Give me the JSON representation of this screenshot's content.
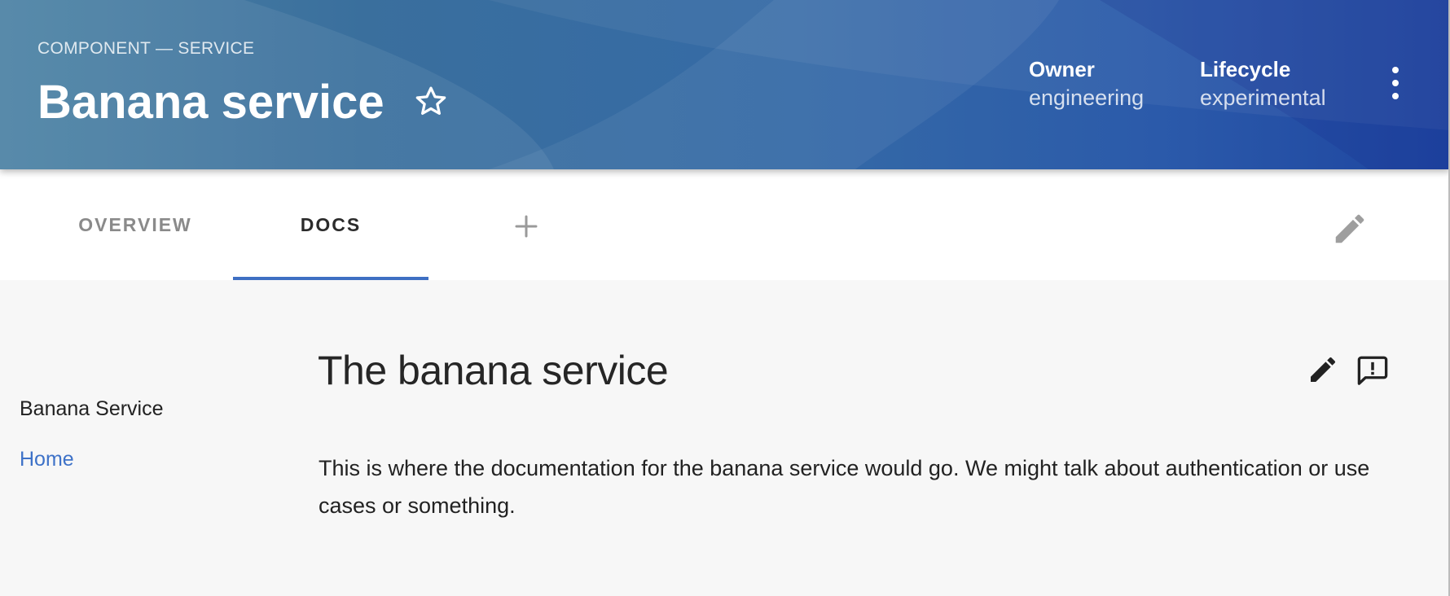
{
  "header": {
    "eyebrow": "COMPONENT — SERVICE",
    "title": "Banana service",
    "star_icon": "star-outline-icon",
    "owner": {
      "label": "Owner",
      "value": "engineering"
    },
    "lifecycle": {
      "label": "Lifecycle",
      "value": "experimental"
    },
    "more_icon": "more-vert-icon",
    "gradient_colors": [
      "#4c82a4",
      "#356aa6",
      "#1e45a0"
    ]
  },
  "tabs": {
    "items": [
      {
        "label": "OVERVIEW",
        "active": false
      },
      {
        "label": "DOCS",
        "active": true
      }
    ],
    "add_icon": "plus-icon",
    "edit_icon": "pencil-icon",
    "indicator_color": "#3e6fc3"
  },
  "sidebar": {
    "title": "Banana Service",
    "links": [
      {
        "label": "Home"
      }
    ],
    "link_color": "#3e72c8"
  },
  "doc": {
    "title": "The banana service",
    "body": "This is where the documentation for the banana service would go. We might talk about authentication or use cases or something.",
    "edit_icon": "pencil-icon",
    "feedback_icon": "feedback-icon"
  }
}
